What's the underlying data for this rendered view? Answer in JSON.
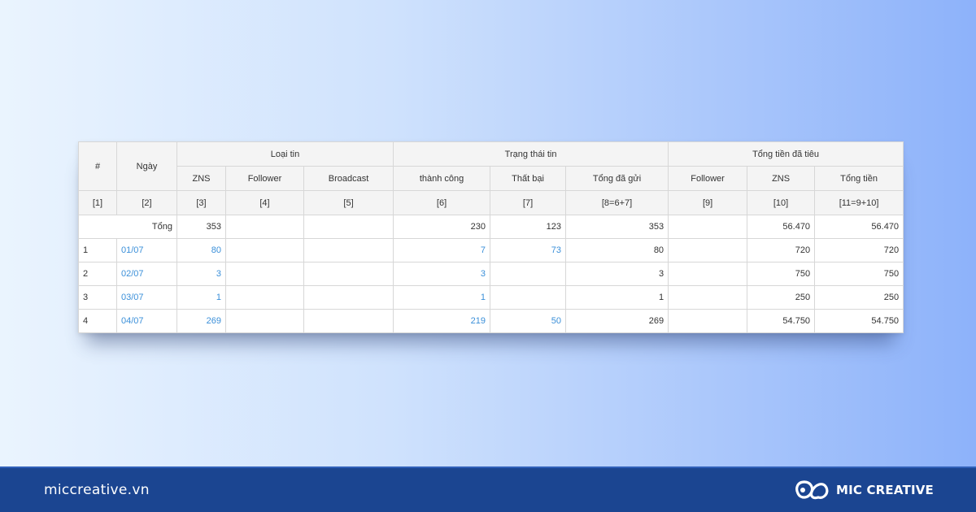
{
  "table": {
    "header": {
      "index": "#",
      "date": "Ngày",
      "group_message_type": "Loại tin",
      "group_message_status": "Trạng thái tin",
      "group_total_spent": "Tổng tiền đã tiêu",
      "columns": [
        "ZNS",
        "Follower",
        "Broadcast",
        "thành công",
        "Thất bại",
        "Tổng đã gửi",
        "Follower",
        "ZNS",
        "Tổng tiền"
      ],
      "codes": [
        "[1]",
        "[2]",
        "[3]",
        "[4]",
        "[5]",
        "[6]",
        "[7]",
        "[8=6+7]",
        "[9]",
        "[10]",
        "[11=9+10]"
      ]
    },
    "total_row": {
      "label": "Tổng",
      "zns": "353",
      "follower": "",
      "broadcast": "",
      "success": "230",
      "failed": "123",
      "sent": "353",
      "spent_follower": "",
      "spent_zns": "56.470",
      "spent_total": "56.470"
    },
    "rows": [
      {
        "index": "1",
        "date": "01/07",
        "zns": "80",
        "follower": "",
        "broadcast": "",
        "success": "7",
        "failed": "73",
        "sent": "80",
        "spent_follower": "",
        "spent_zns": "720",
        "spent_total": "720"
      },
      {
        "index": "2",
        "date": "02/07",
        "zns": "3",
        "follower": "",
        "broadcast": "",
        "success": "3",
        "failed": "",
        "sent": "3",
        "spent_follower": "",
        "spent_zns": "750",
        "spent_total": "750"
      },
      {
        "index": "3",
        "date": "03/07",
        "zns": "1",
        "follower": "",
        "broadcast": "",
        "success": "1",
        "failed": "",
        "sent": "1",
        "spent_follower": "",
        "spent_zns": "250",
        "spent_total": "250"
      },
      {
        "index": "4",
        "date": "04/07",
        "zns": "269",
        "follower": "",
        "broadcast": "",
        "success": "219",
        "failed": "50",
        "sent": "269",
        "spent_follower": "",
        "spent_zns": "54.750",
        "spent_total": "54.750"
      }
    ]
  },
  "footer": {
    "website": "miccreative.vn",
    "brand": "MIC CREATIVE"
  },
  "colors": {
    "link": "#3a8fd9",
    "footer_bg": "#1b4591"
  },
  "icons": {
    "brand_logo": "mic-creative-logo-icon"
  }
}
